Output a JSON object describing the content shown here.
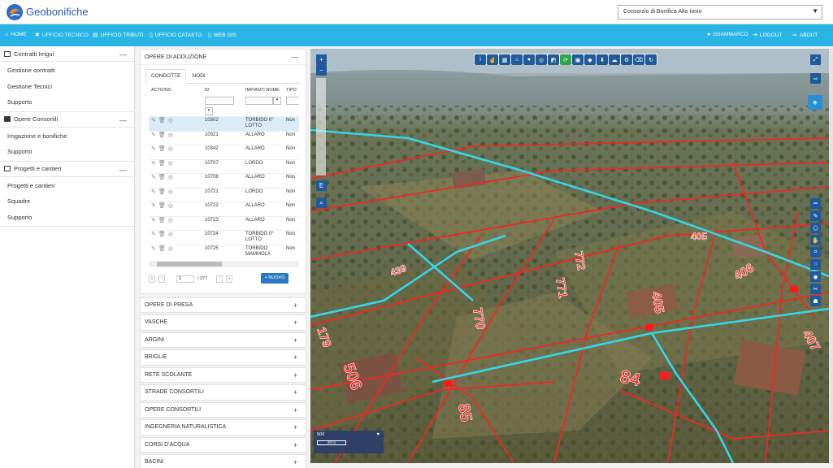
{
  "app": {
    "title": "Geobonifiche"
  },
  "consorzio_select": {
    "value": "Consorzio di Bonifica Alto Ionio"
  },
  "nav": {
    "home": "HOME",
    "ufficio_tecnico": "UFFICIO TECNICO",
    "ufficio_tributi": "UFFICIO TRIBUTI",
    "ufficio_catasto": "UFFICIO CATASTO",
    "web_gis": "WEB GIS",
    "user": "GSAMMARCO",
    "logout": "LOGOUT",
    "about": "ABOUT"
  },
  "sidebar": {
    "sections": [
      {
        "title": "Contratti Irrigui",
        "items": [
          "Gestione contratti",
          "Gestione Tecnici",
          "Supporto"
        ]
      },
      {
        "title": "Opere Consortili",
        "items": [
          "Irrigazione e bonifiche",
          "Supporto"
        ]
      },
      {
        "title": "Progetti e cantieri",
        "items": [
          "Progetti e cantieri",
          "Squadre",
          "Supporto"
        ]
      }
    ]
  },
  "panel": {
    "title": "OPERE DI ADDUZIONE",
    "tabs": [
      "CONDOTTE",
      "NODI"
    ],
    "columns": [
      "ACTIONS",
      "ID",
      "IMPIANTI NOME",
      "TIPO"
    ],
    "rows": [
      {
        "id": "10302",
        "nome": "TORBIDO II° LOTTO",
        "tipo": "Non"
      },
      {
        "id": "10321",
        "nome": "ALLARO",
        "tipo": "Non"
      },
      {
        "id": "10342",
        "nome": "ALLARO",
        "tipo": "Non"
      },
      {
        "id": "10707",
        "nome": "LORDO",
        "tipo": "Non"
      },
      {
        "id": "10708",
        "nome": "ALLARO",
        "tipo": "Non"
      },
      {
        "id": "10721",
        "nome": "LORDO",
        "tipo": "Non"
      },
      {
        "id": "10722",
        "nome": "ALLARO",
        "tipo": "Non"
      },
      {
        "id": "10723",
        "nome": "ALLARO",
        "tipo": "Non"
      },
      {
        "id": "10724",
        "nome": "TORBIDO II° LOTTO",
        "tipo": "Non"
      },
      {
        "id": "10725",
        "nome": "TORBIDO MAMMOLA",
        "tipo": "Non"
      }
    ],
    "pager": {
      "page": "1",
      "total": "/ 377"
    },
    "new_button": "NUOVO"
  },
  "accordions": [
    "OPERE DI PRESA",
    "VASCHE",
    "ARGINI",
    "BRIGLIE",
    "RETE SCOLANTE",
    "STRADE CONSORTILI",
    "OPERE CONSORTILI",
    "INGEGNERIA NATURALISTICA",
    "CORSI D'ACQUA",
    "BACINI"
  ],
  "map": {
    "scale_value": "500",
    "scale_bar": "20 m",
    "parcel_labels": [
      "84",
      "85",
      "506",
      "179",
      "771",
      "772",
      "770",
      "405",
      "406",
      "405",
      "407",
      "439"
    ],
    "colors": {
      "parcel": "#ff2020",
      "pipe": "#34d6e8"
    }
  }
}
